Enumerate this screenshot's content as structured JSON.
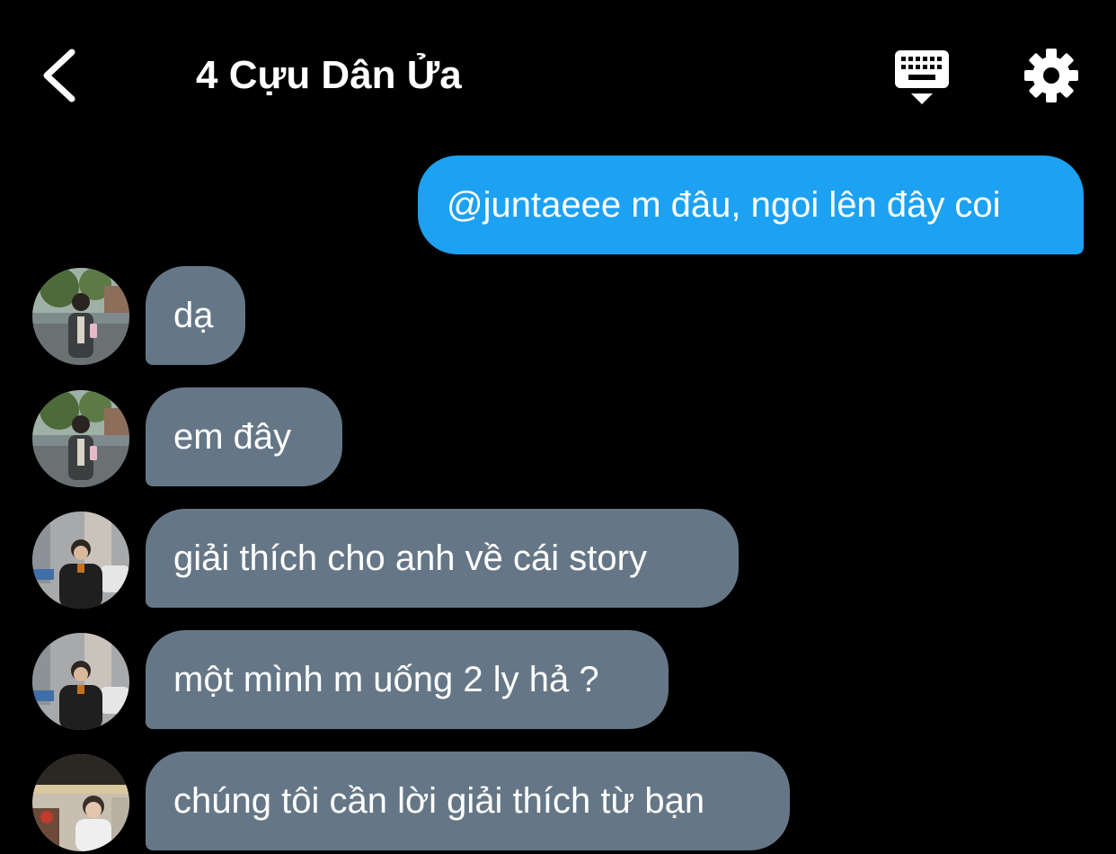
{
  "header": {
    "title": "4 Cựu Dân Ửa",
    "back_icon": "chevron-left-icon",
    "keyboard_icon": "keyboard-icon",
    "settings_icon": "gear-icon"
  },
  "colors": {
    "background": "#000000",
    "outgoing_bubble": "#1da1f2",
    "incoming_bubble": "#657786",
    "text": "#ffffff"
  },
  "messages": [
    {
      "direction": "outgoing",
      "text": "@juntaeee m đâu, ngoi lên đây coi"
    },
    {
      "direction": "incoming",
      "text": "dạ"
    },
    {
      "direction": "incoming",
      "text": "em đây"
    },
    {
      "direction": "incoming",
      "text": "giải thích cho anh về cái story"
    },
    {
      "direction": "incoming",
      "text": "một mình m uống 2 ly hả ?"
    },
    {
      "direction": "incoming",
      "text": "chúng tôi cần lời giải thích từ bạn"
    }
  ]
}
